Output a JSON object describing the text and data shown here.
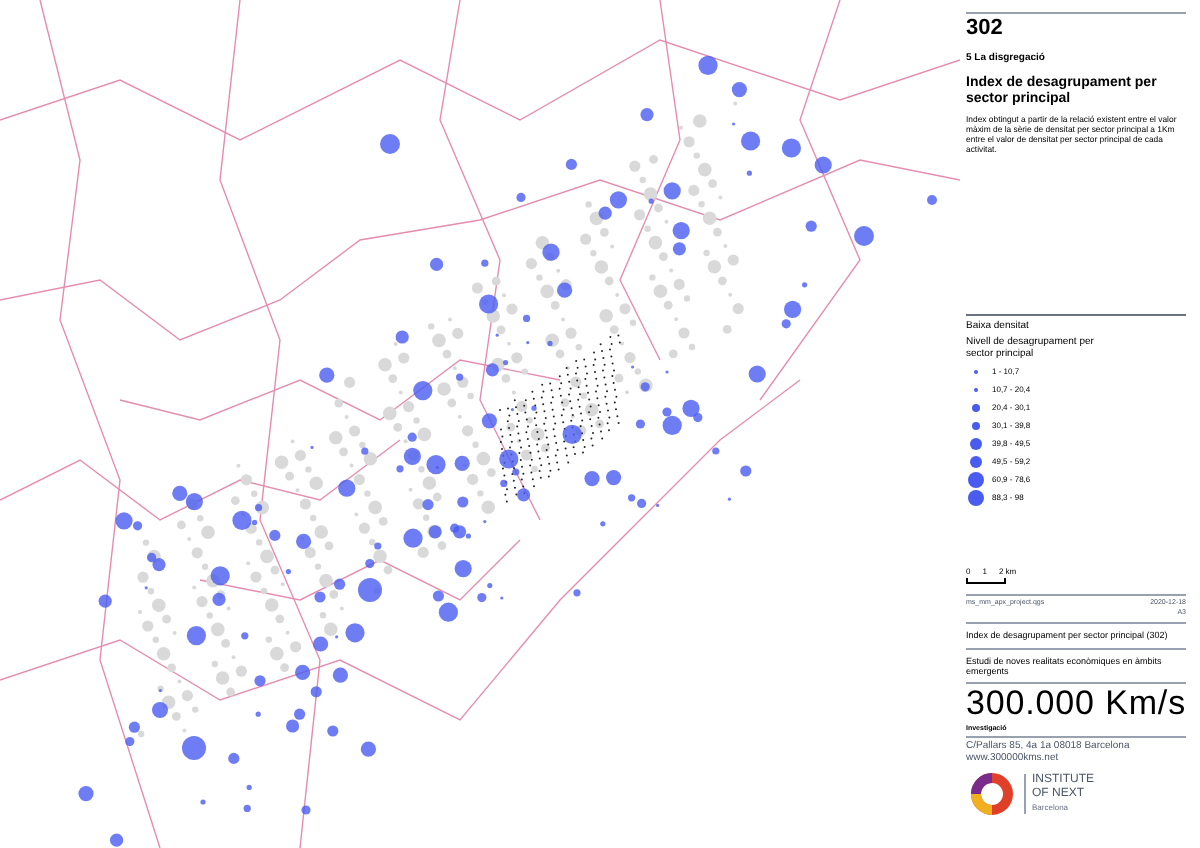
{
  "header": {
    "number": "302",
    "section": "5 La disgregació",
    "title": "Index de desagrupament per sector principal",
    "description": "Index obtingut a partir de la relació existent entre el valor màxim de la sèrie de densitat per sector principal a 1Km entre el valor de densitat per sector principal de cada activitat."
  },
  "legend": {
    "heading": "Baixa densitat",
    "subtitle": "Nivell de desagrupament per sector principal",
    "classes": [
      {
        "label": "1 - 10,7"
      },
      {
        "label": "10,7 - 20,4"
      },
      {
        "label": "20,4 - 30,1"
      },
      {
        "label": "30,1 - 39,8"
      },
      {
        "label": "39,8 - 49,5"
      },
      {
        "label": "49,5 - 59,2"
      },
      {
        "label": "60,9 - 78,6"
      },
      {
        "label": "88,3 - 98"
      }
    ]
  },
  "scale_bar": {
    "ticks": [
      "0",
      "1",
      "2 km"
    ]
  },
  "footer": {
    "file": "ms_mm_apx_project.qgs",
    "date": "2020-12-18",
    "paper": "A3",
    "map_title": "Index de desagrupament per sector principal (302)",
    "study": "Estudi de noves realitats econòmiques en àmbits emergents",
    "brand": "300.000 Km/s",
    "tagline": "Investigació",
    "address": "C/Pallars 85, 4a 1a 08018 Barcelona",
    "website": "www.300000kms.net",
    "logo_lines": [
      "INSTITUTE",
      "OF NEXT",
      "Barcelona"
    ]
  }
}
